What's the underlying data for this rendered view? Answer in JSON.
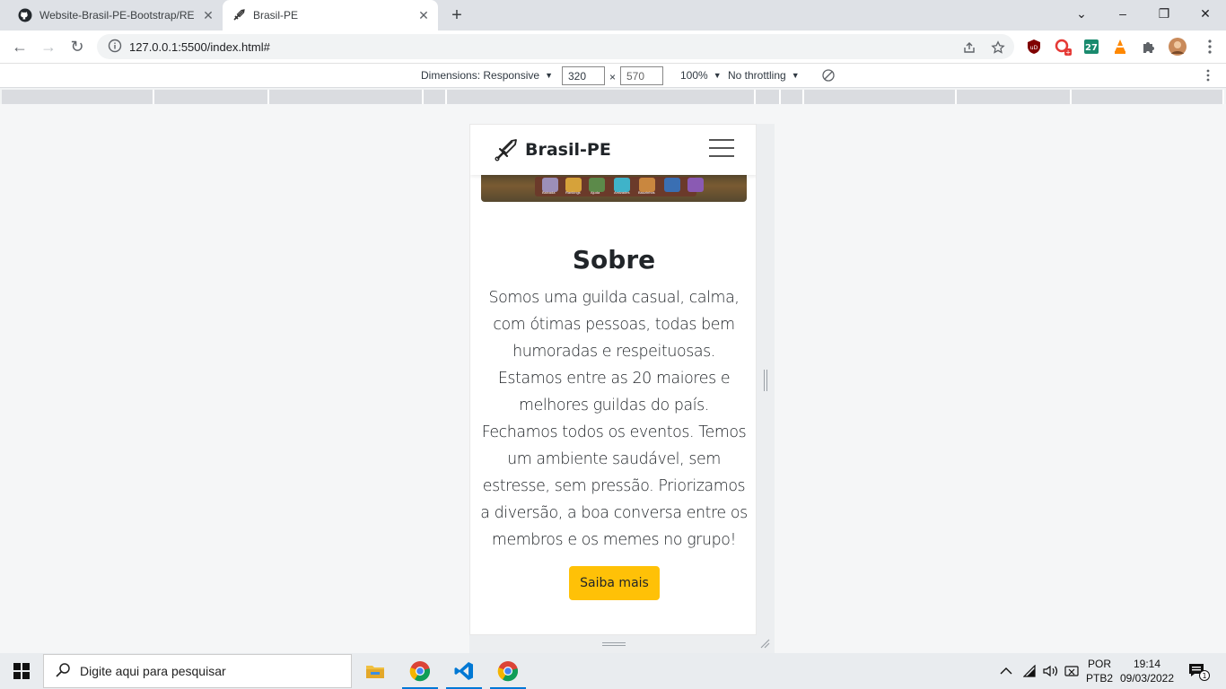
{
  "browser": {
    "tabs": [
      {
        "title": "Website-Brasil-PE-Bootstrap/README",
        "active": false
      },
      {
        "title": "Brasil-PE",
        "active": true
      }
    ],
    "url": "127.0.0.1:5500/index.html#"
  },
  "devtools": {
    "dimensions_label": "Dimensions: Responsive",
    "width_value": "320",
    "height_value": "570",
    "zoom": "100%",
    "throttling": "No throttling"
  },
  "page": {
    "brand": "Brasil-PE",
    "section_title": "Sobre",
    "section_text": "Somos uma guilda casual, calma, com ótimas pessoas, todas bem humoradas e respeituosas. Estamos entre as 20 maiores e melhores guildas do país. Fechamos todos os eventos. Temos um ambiente saudável, sem estresse, sem pressão. Priorizamos a diversão, a boa conversa entre os membros e os memes no grupo!",
    "button_label": "Saiba mais",
    "banner_labels": [
      "Baixada",
      "Rankings",
      "Ajuda",
      "Amizades",
      "Bauzinhos",
      "",
      ""
    ],
    "accent_color": "#ffc107"
  },
  "extensions": {
    "badge_27": "27"
  },
  "taskbar": {
    "search_placeholder": "Digite aqui para pesquisar",
    "lang_line1": "POR",
    "lang_line2": "PTB2",
    "time": "19:14",
    "date": "09/03/2022",
    "notification_count": "1"
  }
}
